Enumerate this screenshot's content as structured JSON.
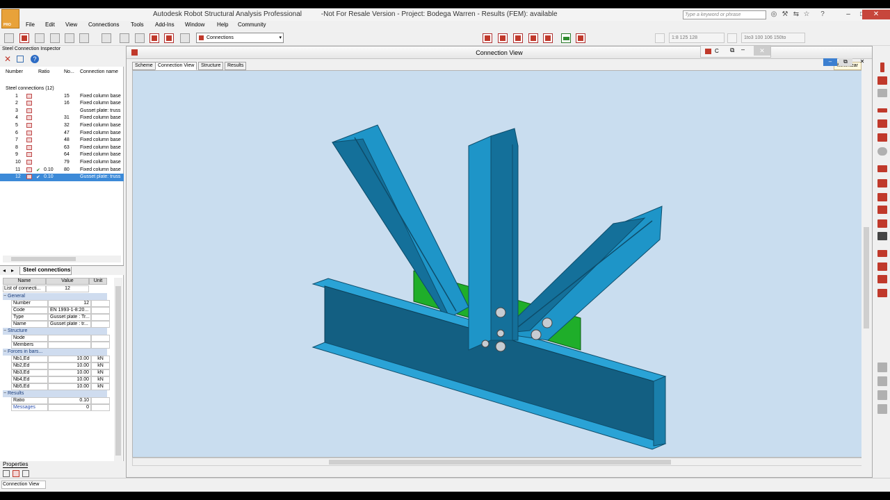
{
  "window": {
    "title": "Autodesk Robot Structural Analysis Professional          -Not For Resale Version - Project: Bodega Warren - Results (FEM): available",
    "search_placeholder": "Type a keyword or phrase",
    "app_badge": "PRO",
    "min": "–",
    "max": "□",
    "close": "✕"
  },
  "menu": [
    "File",
    "Edit",
    "View",
    "Connections",
    "Tools",
    "Add-Ins",
    "Window",
    "Help",
    "Community"
  ],
  "toolbar": {
    "selection_combo": "Connections",
    "scale_combo": "1:8 125 128",
    "section_combo": "1to3 100 106 150to"
  },
  "inspector": {
    "title": "Steel Connection Inspector",
    "columns": [
      "Number",
      "Ratio",
      "No...",
      "Connection name"
    ],
    "root": "Steel connections (12)",
    "rows": [
      {
        "num": "1",
        "ratio": "",
        "no": "15",
        "name": "Fixed column base"
      },
      {
        "num": "2",
        "ratio": "",
        "no": "16",
        "name": "Fixed column base"
      },
      {
        "num": "3",
        "ratio": "",
        "no": "",
        "name": "Gusset plate: truss"
      },
      {
        "num": "4",
        "ratio": "",
        "no": "31",
        "name": "Fixed column base"
      },
      {
        "num": "5",
        "ratio": "",
        "no": "32",
        "name": "Fixed column base"
      },
      {
        "num": "6",
        "ratio": "",
        "no": "47",
        "name": "Fixed column base"
      },
      {
        "num": "7",
        "ratio": "",
        "no": "48",
        "name": "Fixed column base"
      },
      {
        "num": "8",
        "ratio": "",
        "no": "63",
        "name": "Fixed column base"
      },
      {
        "num": "9",
        "ratio": "",
        "no": "64",
        "name": "Fixed column base"
      },
      {
        "num": "10",
        "ratio": "",
        "no": "79",
        "name": "Fixed column base"
      },
      {
        "num": "11",
        "ratio": "0.10",
        "no": "80",
        "name": "Fixed column base"
      },
      {
        "num": "12",
        "ratio": "0.10",
        "no": "",
        "name": "Gusset plate: truss"
      }
    ],
    "tab": "Steel connections"
  },
  "properties": {
    "columns": [
      "Name",
      "Value",
      "Unit"
    ],
    "list_label": "List of connecti...",
    "list_value": "12",
    "groups": [
      {
        "label": "General",
        "rows": [
          {
            "name": "Number",
            "value": "12",
            "unit": ""
          },
          {
            "name": "Code",
            "value": "EN 1993-1-8:20...",
            "unit": ""
          },
          {
            "name": "Type",
            "value": "Gusset plate : Tr...",
            "unit": ""
          },
          {
            "name": "Name",
            "value": "Gusset plate : tr...",
            "unit": ""
          }
        ]
      },
      {
        "label": "Structure",
        "rows": [
          {
            "name": "Node",
            "value": "",
            "unit": ""
          },
          {
            "name": "Members",
            "value": "",
            "unit": ""
          }
        ]
      },
      {
        "label": "Forces in bars...",
        "rows": [
          {
            "name": "Nb1,Ed",
            "value": "10.00",
            "unit": "kN"
          },
          {
            "name": "Nb2,Ed",
            "value": "10.00",
            "unit": "kN"
          },
          {
            "name": "Nb3,Ed",
            "value": "10.00",
            "unit": "kN"
          },
          {
            "name": "Nb4,Ed",
            "value": "10.00",
            "unit": "kN"
          },
          {
            "name": "Nb5,Ed",
            "value": "10.00",
            "unit": "kN"
          }
        ]
      },
      {
        "label": "Results",
        "rows": [
          {
            "name": "Ratio",
            "value": "0.10",
            "unit": ""
          },
          {
            "name": "Messages",
            "value": "0",
            "unit": ""
          }
        ]
      }
    ],
    "tab": "Properties"
  },
  "view": {
    "title": "Connection View",
    "tabs": [
      "Scheme",
      "Connection View",
      "Structure",
      "Results"
    ],
    "active_tab": "Connection View",
    "minimize_label": "Minimizar",
    "float_window_label": "C"
  },
  "status": {
    "field": "Connection View"
  },
  "colors": {
    "steel": "#1e95c8",
    "steel_dark": "#135f82",
    "gusset": "#1fae2a",
    "canvas": "#c9ddef",
    "accent": "#c0392b"
  }
}
